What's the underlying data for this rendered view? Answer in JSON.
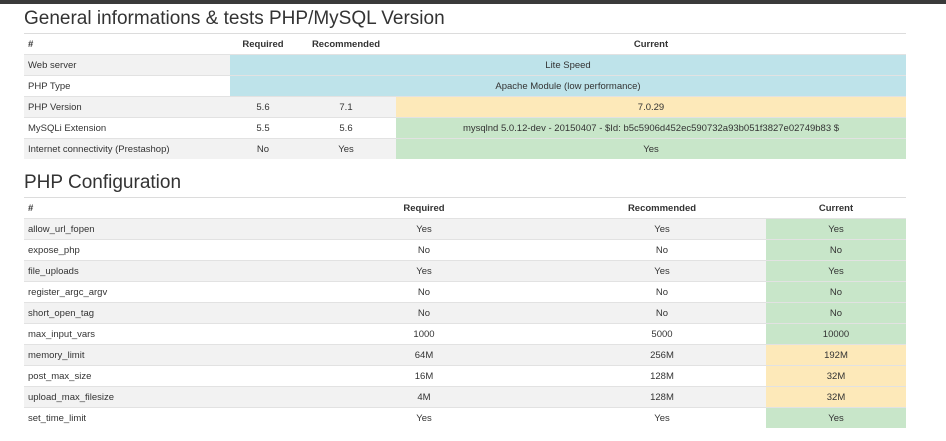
{
  "general": {
    "title": "General informations & tests PHP/MySQL Version",
    "headers": {
      "name": "#",
      "required": "Required",
      "recommended": "Recommended",
      "current": "Current"
    },
    "rows": [
      {
        "name": "Web server",
        "required": "",
        "recommended": "",
        "current": "Lite Speed",
        "status": "info",
        "span": true
      },
      {
        "name": "PHP Type",
        "required": "",
        "recommended": "",
        "current": "Apache Module (low performance)",
        "status": "info",
        "span": true
      },
      {
        "name": "PHP Version",
        "required": "5.6",
        "recommended": "7.1",
        "current": "7.0.29",
        "status": "warn",
        "span": false
      },
      {
        "name": "MySQLi Extension",
        "required": "5.5",
        "recommended": "5.6",
        "current": "mysqlnd 5.0.12-dev - 20150407 - $Id: b5c5906d452ec590732a93b051f3827e02749b83 $",
        "status": "ok",
        "span": false
      },
      {
        "name": "Internet connectivity (Prestashop)",
        "required": "No",
        "recommended": "Yes",
        "current": "Yes",
        "status": "ok",
        "span": false
      }
    ]
  },
  "php_config": {
    "title": "PHP Configuration",
    "headers": {
      "name": "#",
      "required": "Required",
      "recommended": "Recommended",
      "current": "Current"
    },
    "rows": [
      {
        "name": "allow_url_fopen",
        "required": "Yes",
        "recommended": "Yes",
        "current": "Yes",
        "status": "ok"
      },
      {
        "name": "expose_php",
        "required": "No",
        "recommended": "No",
        "current": "No",
        "status": "ok"
      },
      {
        "name": "file_uploads",
        "required": "Yes",
        "recommended": "Yes",
        "current": "Yes",
        "status": "ok"
      },
      {
        "name": "register_argc_argv",
        "required": "No",
        "recommended": "No",
        "current": "No",
        "status": "ok"
      },
      {
        "name": "short_open_tag",
        "required": "No",
        "recommended": "No",
        "current": "No",
        "status": "ok"
      },
      {
        "name": "max_input_vars",
        "required": "1000",
        "recommended": "5000",
        "current": "10000",
        "status": "ok"
      },
      {
        "name": "memory_limit",
        "required": "64M",
        "recommended": "256M",
        "current": "192M",
        "status": "warn"
      },
      {
        "name": "post_max_size",
        "required": "16M",
        "recommended": "128M",
        "current": "32M",
        "status": "warn"
      },
      {
        "name": "upload_max_filesize",
        "required": "4M",
        "recommended": "128M",
        "current": "32M",
        "status": "warn"
      },
      {
        "name": "set_time_limit",
        "required": "Yes",
        "recommended": "Yes",
        "current": "Yes",
        "status": "ok"
      }
    ]
  },
  "colors": {
    "info": "#bee3ea",
    "ok": "#c8e6c9",
    "warn": "#fde9b9"
  }
}
